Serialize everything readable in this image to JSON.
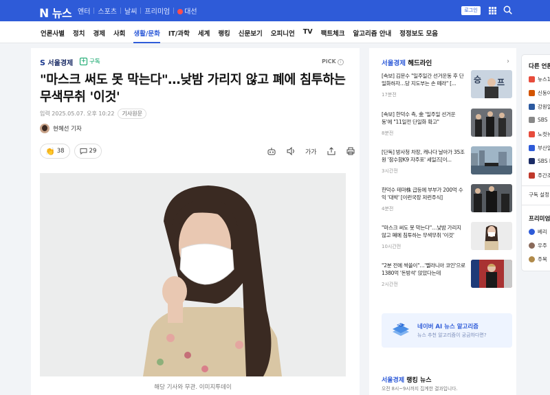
{
  "top": {
    "logo_n": "N",
    "logo_text": "뉴스",
    "nav": [
      "엔터",
      "스포츠",
      "날씨",
      "프리미엄",
      "대선"
    ],
    "login": "로그인"
  },
  "categories": [
    "언론사별",
    "정치",
    "경제",
    "사회",
    "생활/문화",
    "IT/과학",
    "세계",
    "랭킹",
    "신문보기",
    "오피니언",
    "TV",
    "팩트체크",
    "알고리즘 안내",
    "정정보도 모음"
  ],
  "active_category": "생활/문화",
  "article": {
    "press": "서울경제",
    "subscribe": "구독",
    "pick": "PiCK",
    "headline": "\"마스크 써도 못 막는다\"…낮밤 가리지 않고 폐에 침투하는 무색무취 '이것'",
    "date": "입력 2025.05.07. 오후 10:22",
    "original": "기사원문",
    "reporter": "현혜선 기자",
    "like_count": "38",
    "comment_count": "29",
    "font_tool": "가가",
    "caption": "해당 기사와 무관. 이미지투데이"
  },
  "sidebar": {
    "press": "서울경제",
    "head_suffix": " 헤드라인",
    "items": [
      {
        "text": "[속보] 김문수 \"일주일간 선거운동 후 단일화하자…당 지도부는 손 떼라\" [...",
        "time": "17분전"
      },
      {
        "text": "[속보] 한덕수 측, 金 '일주일 선거운동'에 \"11일전 단일화 확고\"",
        "time": "8분전"
      },
      {
        "text": "[단독] 방사청 차장, 캐나다 날아가 35조원 '잠수함K9 자주포' 세일즈[이...",
        "time": "3시간전"
      },
      {
        "text": "한덕수 테마株 급등에 부부가 200억 수익 '대박' [이런국장 저런주식]",
        "time": "4분전"
      },
      {
        "text": "\"마스크 써도 못 막는다\"…낮밤 가리지 않고 폐에 침투하는 무색무취 '이것'",
        "time": "10시간전"
      },
      {
        "text": "\"2분 전에 싹쓸이\"…'멜라니아 코인'으로 1380억 '돈방석' 앉았다는데",
        "time": "2시간전"
      }
    ],
    "ai_title": "네이버 AI 뉴스 알고리즘",
    "ai_sub": "뉴스 추천 알고리즘이 궁금하다면?",
    "rank_press": "서울경제",
    "rank_suffix": " 랭킹 뉴스",
    "rank_sub": "오전 8시~9시까지 집계한 결과입니다."
  },
  "right_panel": {
    "title": "다른 언론사",
    "items": [
      "뉴스1",
      "신동아",
      "강원일보",
      "SBS",
      "노컷뉴스",
      "부산일보",
      "SBS Biz",
      "주간조선"
    ],
    "item_colors": [
      "#e74c3c",
      "#d35400",
      "#2c5aa0",
      "#888888",
      "#e74c3c",
      "#2e5bd8",
      "#1b2c66",
      "#c0392b"
    ],
    "subscribe_setting": "구독 설정",
    "premium_title": "프리미엄",
    "premium_items": [
      "베리",
      "우주",
      "주목"
    ]
  },
  "colors": {
    "brand": "#2e5bd8",
    "subscribe": "#00a060"
  }
}
